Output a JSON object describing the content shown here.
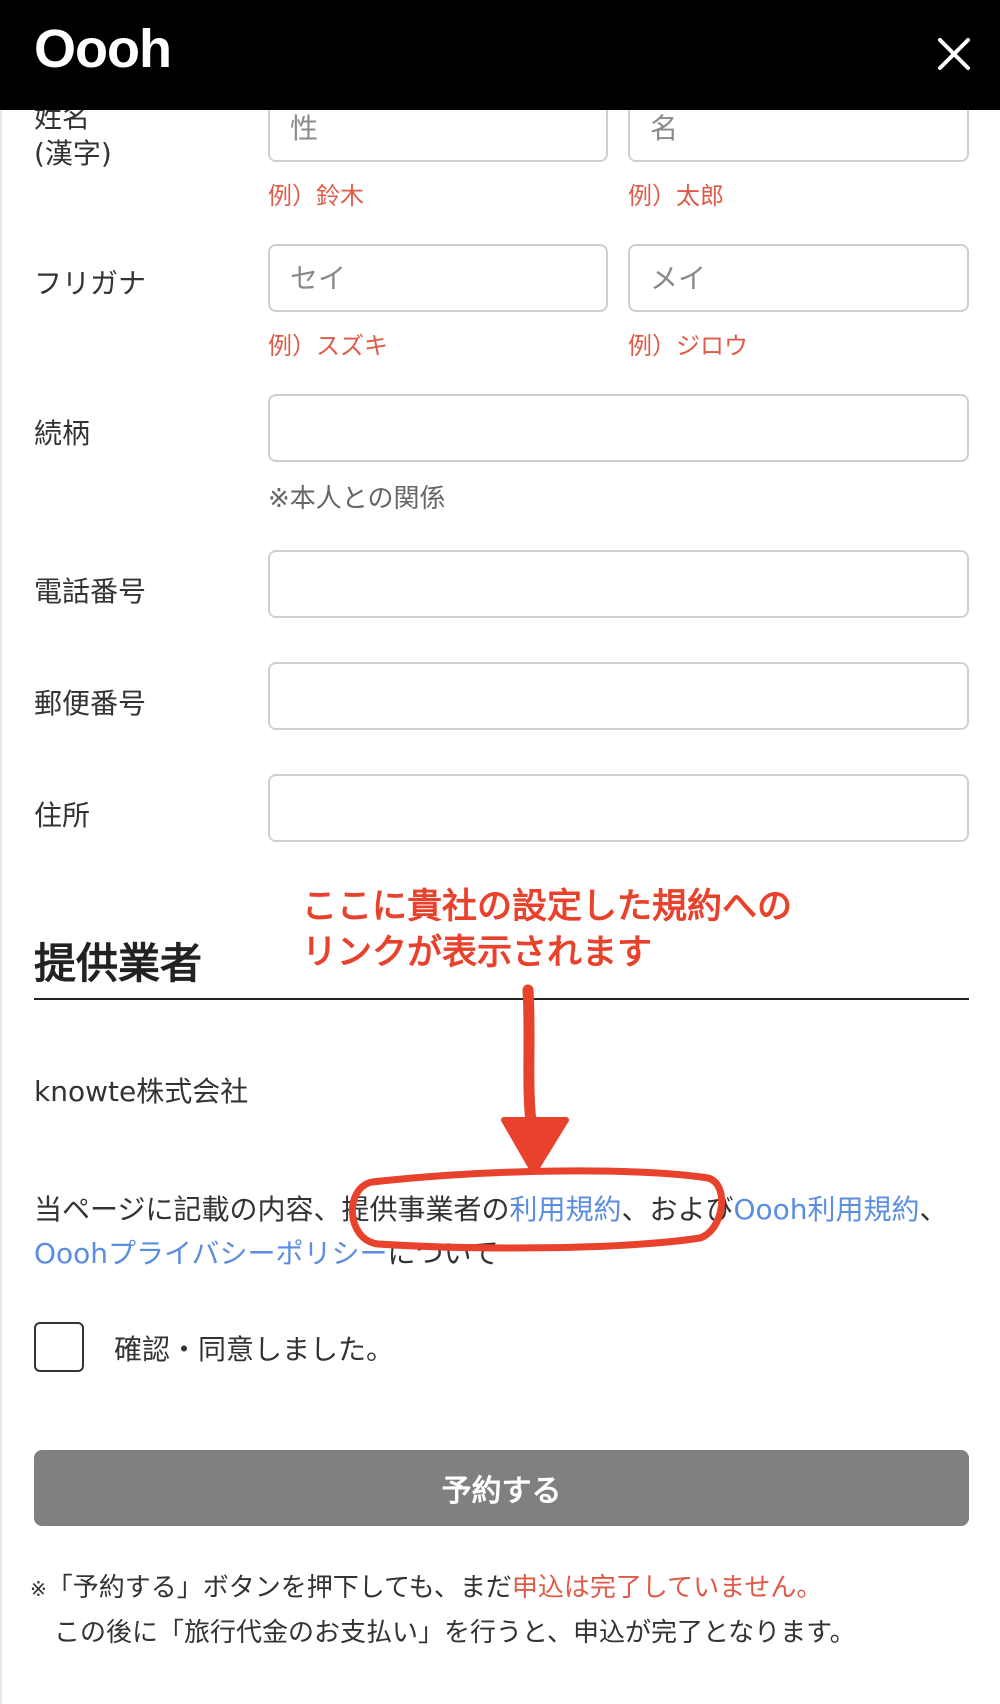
{
  "header": {
    "logo": "Oooh",
    "close_icon": "close-icon"
  },
  "form": {
    "name_kanji": {
      "label_line1": "姓名",
      "label_line2": "(漢字)",
      "last_placeholder": "性",
      "first_placeholder": "名",
      "last_example": "例）鈴木",
      "first_example": "例）太郎"
    },
    "furigana": {
      "label": "フリガナ",
      "last_placeholder": "セイ",
      "first_placeholder": "メイ",
      "last_example": "例）スズキ",
      "first_example": "例）ジロウ"
    },
    "relationship": {
      "label": "続柄",
      "value": "",
      "note": "※本人との関係"
    },
    "phone": {
      "label": "電話番号",
      "value": ""
    },
    "postal": {
      "label": "郵便番号",
      "value": ""
    },
    "address": {
      "label": "住所",
      "value": ""
    }
  },
  "provider": {
    "title": "提供業者",
    "company": "knowte株式会社"
  },
  "annotation": {
    "line1": "ここに貴社の設定した規約への",
    "line2": "リンクが表示されます",
    "color": "#e8412c"
  },
  "consent": {
    "prefix": "当ページに記載の内容、提供事業者の",
    "terms_link": "利用規約",
    "middle": "、および",
    "oooh_terms_link": "Oooh利用規約",
    "separator": "、",
    "privacy_link": "Ooohプライバシーポリシー",
    "suffix": "について",
    "checkbox_label": "確認・同意しました。",
    "checked": false
  },
  "submit": {
    "label": "予約する"
  },
  "note": {
    "mark": "※",
    "text1": "「予約する」ボタンを押下しても、まだ",
    "red_text": "申込は完了していません。",
    "text2": "この後に「旅行代金のお支払い」を行うと、申込が完了となります。"
  },
  "colors": {
    "accent_red": "#e05a47",
    "link_blue": "#5b8de0",
    "button_grey": "#808080",
    "header_black": "#000000"
  }
}
